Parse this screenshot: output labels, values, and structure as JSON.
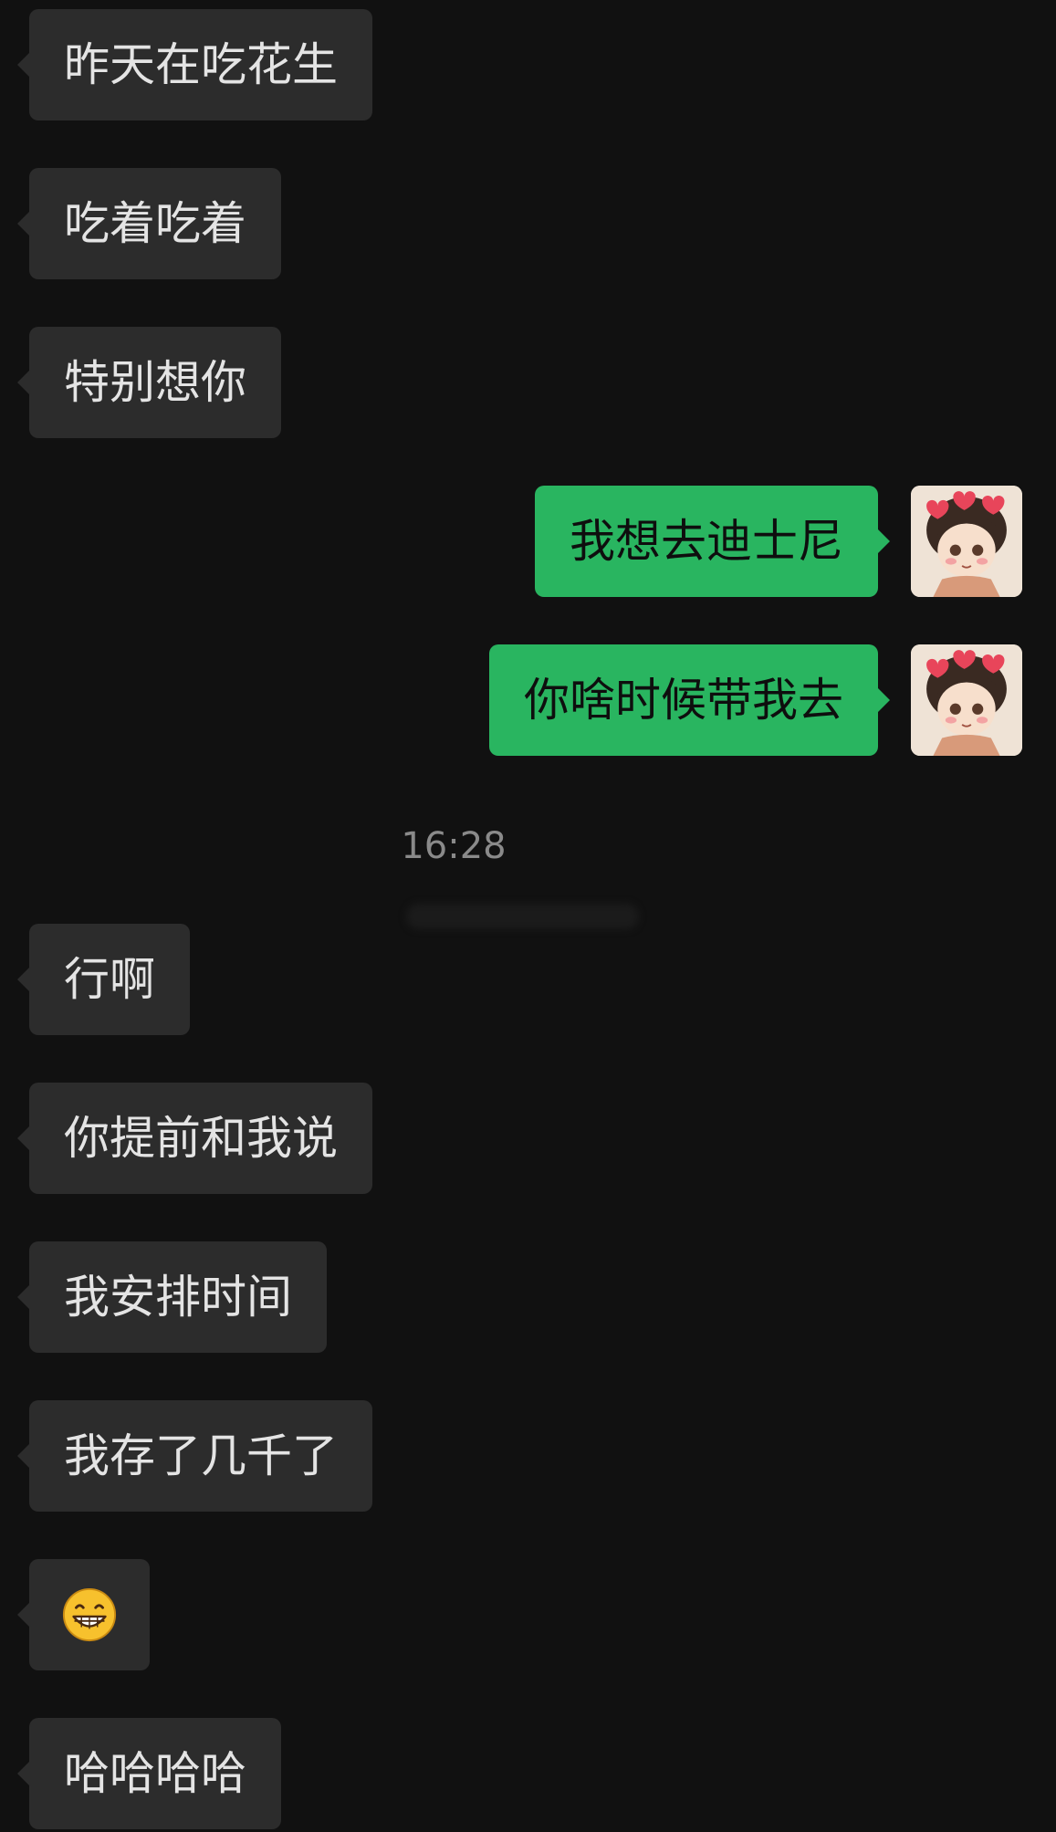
{
  "messages": [
    {
      "side": "in",
      "text": "昨天在吃花生"
    },
    {
      "side": "in",
      "text": "吃着吃着"
    },
    {
      "side": "in",
      "text": "特别想你"
    },
    {
      "side": "out",
      "text": "我想去迪士尼"
    },
    {
      "side": "out",
      "text": "你啥时候带我去"
    },
    {
      "side": "in",
      "text": "行啊"
    },
    {
      "side": "in",
      "text": "你提前和我说"
    },
    {
      "side": "in",
      "text": "我安排时间"
    },
    {
      "side": "in",
      "text": "我存了几千了"
    },
    {
      "side": "in",
      "emoji": "grinning-face-emoji"
    },
    {
      "side": "in",
      "text": "哈哈哈哈"
    }
  ],
  "timestamp": "16:28",
  "avatar_icon": "anime-girl-avatar",
  "colors": {
    "background": "#111111",
    "incoming_bubble": "#2c2c2c",
    "outgoing_bubble": "#29b560"
  }
}
